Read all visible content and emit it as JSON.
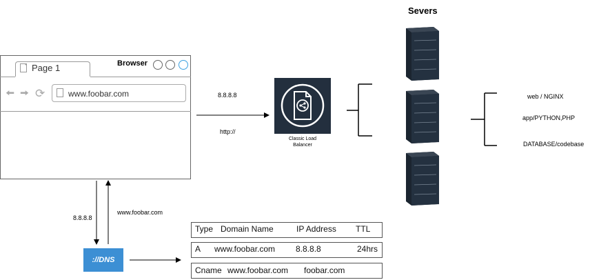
{
  "browser": {
    "title": "Browser",
    "tab_label": "Page 1",
    "url": "www.foobar.com"
  },
  "edges": {
    "to_lb_top": "8.8.8.8",
    "to_lb_bottom": "http://",
    "to_dns_left": "8.8.8.8",
    "from_dns_right": "www.foobar.com"
  },
  "load_balancer": {
    "label_line1": "Classic Load",
    "label_line2": "Balancer"
  },
  "servers": {
    "title": "Severs",
    "stack": [
      "web / NGINX",
      "app/PYTHON,PHP",
      "DATABASE/codebase"
    ]
  },
  "dns": {
    "label": "://DNS",
    "table": {
      "headers": [
        "Type",
        "Domain Name",
        "IP Address",
        "TTL"
      ],
      "rows": [
        [
          "A",
          "www.foobar.com",
          "8.8.8.8",
          "24hrs"
        ],
        [
          "Cname",
          "www.foobar.com",
          "foobar.com",
          ""
        ]
      ]
    }
  },
  "colors": {
    "lb_background": "#232f3e",
    "dns_blue": "#3c8fd4",
    "server_dark": "#1b2530"
  }
}
